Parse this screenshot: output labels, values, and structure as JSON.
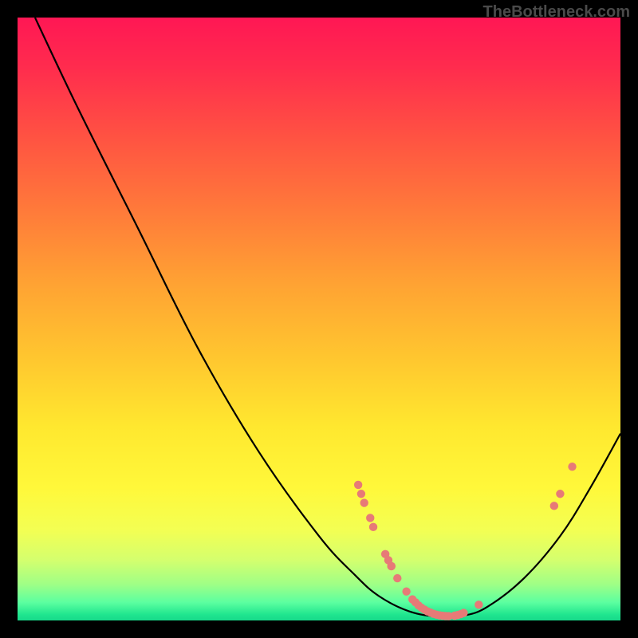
{
  "watermark": "TheBottleneck.com",
  "chart_data": {
    "type": "line",
    "title": "",
    "xlabel": "",
    "ylabel": "",
    "xlim": [
      0,
      100
    ],
    "ylim": [
      0,
      100
    ],
    "grid": false,
    "curve": [
      {
        "x": 2.9,
        "y": 100
      },
      {
        "x": 10,
        "y": 85
      },
      {
        "x": 20,
        "y": 65
      },
      {
        "x": 30,
        "y": 45
      },
      {
        "x": 40,
        "y": 28
      },
      {
        "x": 50,
        "y": 14
      },
      {
        "x": 56,
        "y": 7.5
      },
      {
        "x": 60,
        "y": 4
      },
      {
        "x": 65,
        "y": 1.5
      },
      {
        "x": 70,
        "y": 0.6
      },
      {
        "x": 74,
        "y": 0.8
      },
      {
        "x": 78,
        "y": 2.3
      },
      {
        "x": 84,
        "y": 7
      },
      {
        "x": 90,
        "y": 14
      },
      {
        "x": 95,
        "y": 22
      },
      {
        "x": 100,
        "y": 31
      }
    ],
    "markers": [
      {
        "x": 56.5,
        "y": 22.5
      },
      {
        "x": 57,
        "y": 21
      },
      {
        "x": 57.5,
        "y": 19.5
      },
      {
        "x": 58.5,
        "y": 17
      },
      {
        "x": 59,
        "y": 15.5
      },
      {
        "x": 61,
        "y": 11
      },
      {
        "x": 61.5,
        "y": 10
      },
      {
        "x": 62,
        "y": 9
      },
      {
        "x": 62,
        "y": 9
      },
      {
        "x": 63,
        "y": 7
      },
      {
        "x": 64.5,
        "y": 4.8
      },
      {
        "x": 65.5,
        "y": 3.5
      },
      {
        "x": 66,
        "y": 3
      },
      {
        "x": 66.5,
        "y": 2.5
      },
      {
        "x": 67,
        "y": 2.1
      },
      {
        "x": 67.5,
        "y": 1.8
      },
      {
        "x": 68,
        "y": 1.5
      },
      {
        "x": 68.5,
        "y": 1.3
      },
      {
        "x": 69,
        "y": 1.1
      },
      {
        "x": 69.5,
        "y": 0.95
      },
      {
        "x": 70,
        "y": 0.85
      },
      {
        "x": 70.5,
        "y": 0.78
      },
      {
        "x": 71,
        "y": 0.73
      },
      {
        "x": 71.5,
        "y": 0.72
      },
      {
        "x": 72.5,
        "y": 0.8
      },
      {
        "x": 73,
        "y": 0.9
      },
      {
        "x": 73.5,
        "y": 1.05
      },
      {
        "x": 74,
        "y": 1.25
      },
      {
        "x": 76.5,
        "y": 2.6
      },
      {
        "x": 89,
        "y": 19
      },
      {
        "x": 90,
        "y": 21
      },
      {
        "x": 92,
        "y": 25.5
      }
    ],
    "marker_color": "#e77a77",
    "curve_color": "#000000"
  }
}
